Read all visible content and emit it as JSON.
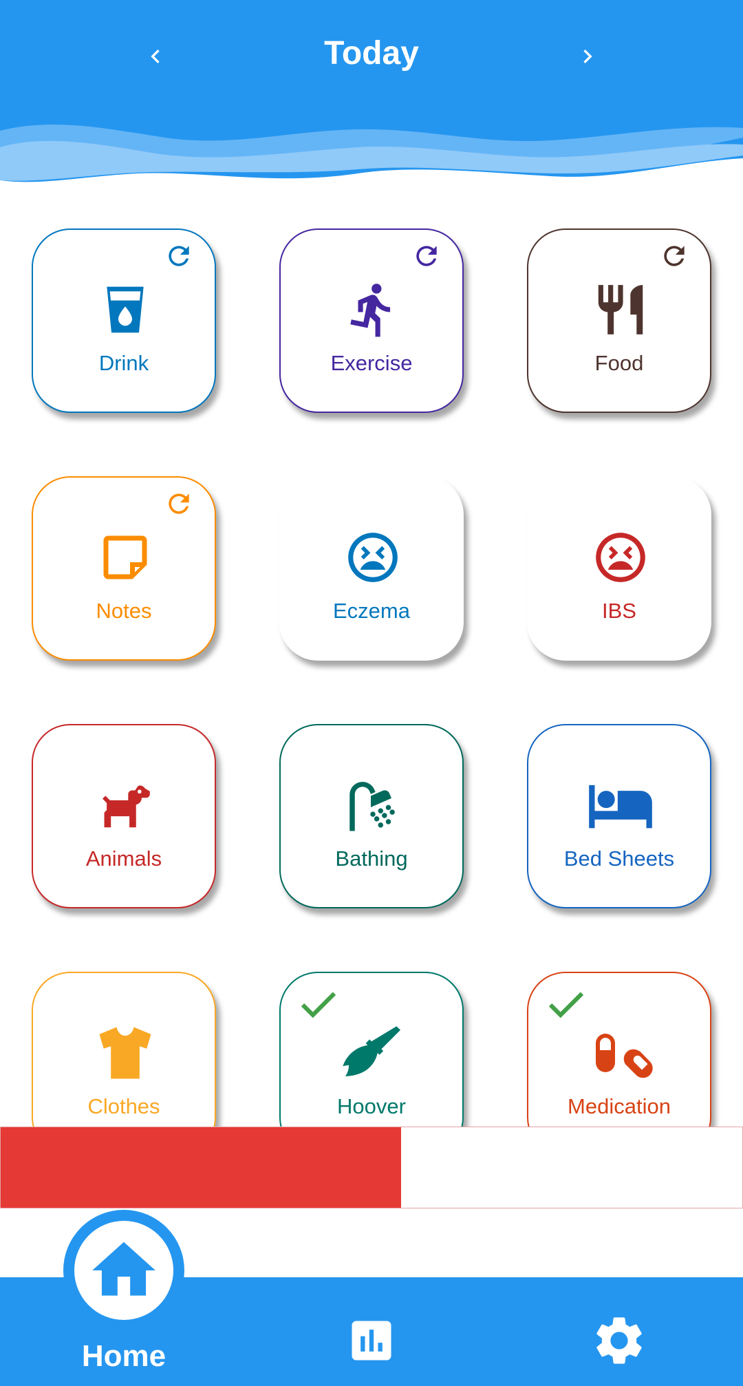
{
  "header": {
    "title": "Today",
    "background_color": "#2596ef",
    "prev_icon": "chevron-left-icon",
    "next_icon": "chevron-right-icon"
  },
  "tiles": [
    {
      "label": "Drink",
      "color": "#0277bd",
      "icon": "cup-water-icon",
      "badge": "refresh"
    },
    {
      "label": "Exercise",
      "color": "#4527a0",
      "icon": "run-icon",
      "badge": "refresh"
    },
    {
      "label": "Food",
      "color": "#4e342e",
      "icon": "fork-knife-icon",
      "badge": "refresh"
    },
    {
      "label": "Notes",
      "color": "#fb8c00",
      "icon": "sticky-note-icon",
      "badge": "refresh"
    },
    {
      "label": "Eczema",
      "color": "#0277bd",
      "icon": "sad-face-icon",
      "badge": "none"
    },
    {
      "label": "IBS",
      "color": "#c62828",
      "icon": "sad-face-icon",
      "badge": "none"
    },
    {
      "label": "Animals",
      "color": "#c62828",
      "icon": "dog-icon",
      "badge": "none"
    },
    {
      "label": "Bathing",
      "color": "#00695c",
      "icon": "shower-icon",
      "badge": "none"
    },
    {
      "label": "Bed Sheets",
      "color": "#1565c0",
      "icon": "bed-icon",
      "badge": "none"
    },
    {
      "label": "Clothes",
      "color": "#f9a825",
      "icon": "shirt-icon",
      "badge": "none"
    },
    {
      "label": "Hoover",
      "color": "#00796b",
      "icon": "broom-icon",
      "badge": "check"
    },
    {
      "label": "Medication",
      "color": "#d84315",
      "icon": "pills-icon",
      "badge": "check"
    }
  ],
  "badge_colors": {
    "check": "#43a047"
  },
  "progress": {
    "fraction": 0.54,
    "fill_color": "#e53935"
  },
  "bottom_nav": {
    "home_label": "Home",
    "home_icon": "home-icon",
    "stats_icon": "bar-chart-icon",
    "settings_icon": "gear-icon"
  }
}
